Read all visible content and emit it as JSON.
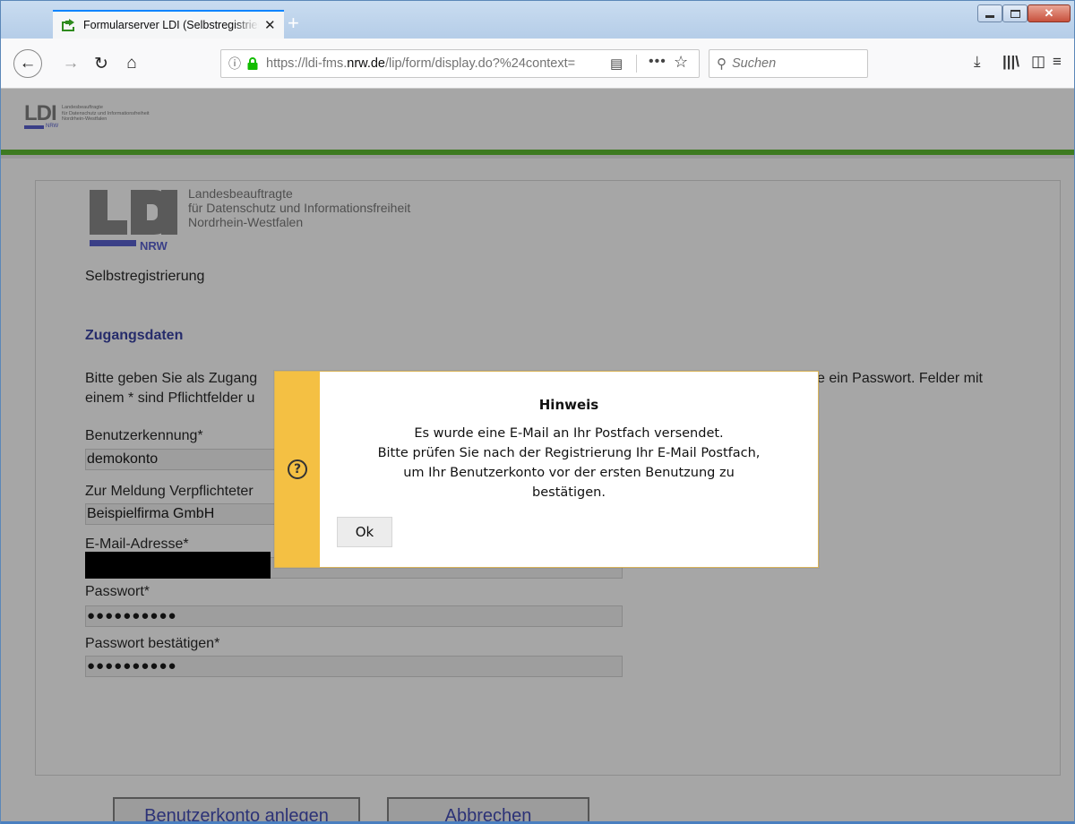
{
  "browser": {
    "tab_title": "Formularserver LDI (Selbstregistrierung)",
    "url_prefix": "https://ldi-fms.",
    "url_domain": "nrw.de",
    "url_rest": "/lip/form/display.do?%24context=",
    "search_placeholder": "Suchen",
    "icons": {
      "back": "back-arrow-icon",
      "forward": "forward-arrow-icon",
      "reload": "reload-icon",
      "home": "home-icon",
      "info": "info-icon",
      "lock": "lock-icon",
      "reader": "reader-view-icon",
      "more": "more-dots-icon",
      "bookmark": "star-icon",
      "search": "search-icon",
      "downloads": "download-icon",
      "library": "library-icon",
      "sidebar": "sidebar-icon",
      "menu": "hamburger-menu-icon"
    }
  },
  "header": {
    "logo_text": "LDI",
    "logo_nrw": "NRW",
    "line1": "Landesbeauftragte",
    "line2": "für Datenschutz und Informationsfreiheit",
    "line3": "Nordrhein-Westfalen"
  },
  "logo": {
    "nrw": "NRW",
    "line1": "Landesbeauftragte",
    "line2": "für Datenschutz und Informationsfreiheit",
    "line3": "Nordrhein-Westfalen"
  },
  "form": {
    "section_title": "Selbstregistrierung",
    "subheading": "Zugangsdaten",
    "intro_line1": "Bitte geben Sie als Zugang",
    "intro_line1_end": "e ein Passwort. Felder mit",
    "intro_line2": "einem * sind Pflichtfelder u",
    "fields": {
      "username_label": "Benutzerkennung*",
      "username_value": "demokonto",
      "company_label": "Zur Meldung Verpflichteter",
      "company_value": "Beispielfirma GmbH",
      "email_label": "E-Mail-Adresse*",
      "password_label": "Passwort*",
      "password_value": "●●●●●●●●●●",
      "password_confirm_label": "Passwort bestätigen*",
      "password_confirm_value": "●●●●●●●●●●"
    },
    "buttons": {
      "create": "Benutzerkonto anlegen",
      "cancel": "Abbrechen"
    }
  },
  "dialog": {
    "title": "Hinweis",
    "icon": "question-circle-icon",
    "message_lines": [
      "Es wurde eine E-Mail an Ihr Postfach versendet.",
      "Bitte prüfen Sie nach der Registrierung Ihr E-Mail Postfach,",
      "um Ihr Benutzerkonto vor der ersten Benutzung zu",
      "bestätigen."
    ],
    "ok_label": "Ok",
    "accent_color": "#f4c043"
  },
  "colors": {
    "firefox_accent": "#0a84ff",
    "header_green": "#3d7a20",
    "ldi_blue": "#3a3f87"
  }
}
